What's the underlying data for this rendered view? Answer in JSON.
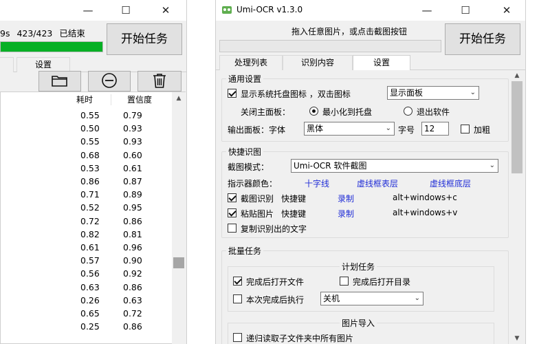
{
  "left_window": {
    "stats": {
      "elapsed": "9s",
      "count": "423/423",
      "status": "已结束"
    },
    "progress_fraction": 1.0,
    "start_button": "开始任务",
    "tabs": [
      "",
      "设置"
    ],
    "table": {
      "headers": [
        "耗时",
        "置信度"
      ],
      "rows": [
        [
          "0.55",
          "0.79"
        ],
        [
          "0.50",
          "0.93"
        ],
        [
          "0.55",
          "0.93"
        ],
        [
          "0.68",
          "0.60"
        ],
        [
          "0.53",
          "0.61"
        ],
        [
          "0.86",
          "0.87"
        ],
        [
          "0.71",
          "0.89"
        ],
        [
          "0.52",
          "0.95"
        ],
        [
          "0.72",
          "0.86"
        ],
        [
          "0.82",
          "0.81"
        ],
        [
          "0.61",
          "0.96"
        ],
        [
          "0.57",
          "0.90"
        ],
        [
          "0.56",
          "0.92"
        ],
        [
          "0.63",
          "0.86"
        ],
        [
          "0.26",
          "0.63"
        ],
        [
          "0.65",
          "0.72"
        ],
        [
          "0.25",
          "0.86"
        ]
      ]
    },
    "icons": [
      "folder-icon",
      "minus-circle-icon",
      "trash-icon"
    ]
  },
  "right_window": {
    "title": "Umi-OCR v1.3.0",
    "hint": "拖入任意图片，或点击截图按钮",
    "start_button": "开始任务",
    "tabs": [
      "处理列表",
      "识别内容",
      "设置"
    ],
    "active_tab": "设置",
    "general": {
      "title": "通用设置",
      "tray_label": "显示系统托盘图标 ，双击图标",
      "tray_checked": true,
      "tray_action": "显示面板",
      "close_label": "关闭主面板：",
      "close_opt1": "最小化到托盘",
      "close_opt2": "退出软件",
      "output_label": "输出面板：字体",
      "font_value": "黑体",
      "size_label": "字号",
      "size_value": "12",
      "bold_label": "加粗"
    },
    "hotkey": {
      "title": "快捷识图",
      "mode_label": "截图模式：",
      "mode_value": "Umi-OCR 软件截图",
      "color_label": "指示器颜色：",
      "color_opt1": "十字线",
      "color_opt2": "虚线框表层",
      "color_opt3": "虚线框底层",
      "screenshot_label": "截图识别",
      "screenshot_hk_label": "快捷键",
      "screenshot_record": "录制",
      "screenshot_hotkey": "alt+windows+c",
      "paste_label": "粘贴图片",
      "paste_hk_label": "快捷键",
      "paste_record": "录制",
      "paste_hotkey": "alt+windows+v",
      "copy_label": "复制识别出的文字"
    },
    "batch": {
      "title": "批量任务",
      "plan_title": "计划任务",
      "open_file_label": "完成后打开文件",
      "open_dir_label": "完成后打开目录",
      "after_label": "本次完成后执行",
      "after_value": "关机",
      "import_title": "图片导入",
      "recursive_label": "递归读取子文件夹中所有图片"
    },
    "accent_blue": "#1f2cd6",
    "progress_green": "#06b025"
  }
}
